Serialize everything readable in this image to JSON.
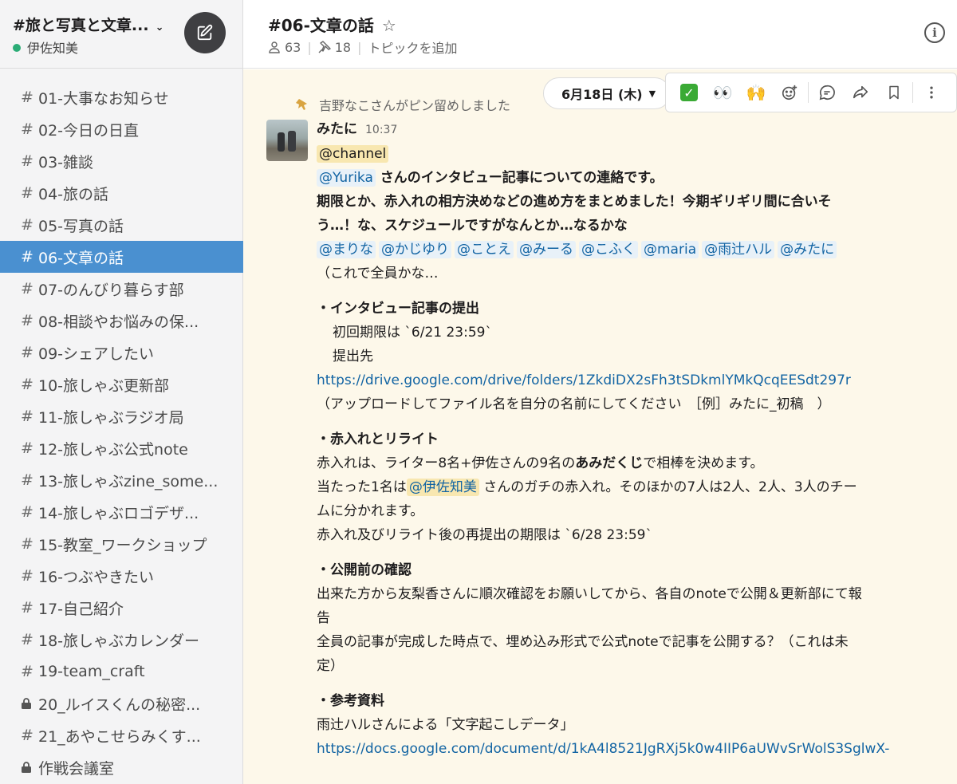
{
  "workspace": {
    "name": "#旅と写真と文章...",
    "chevron": "⌄",
    "user": "伊佐知美"
  },
  "channels": [
    {
      "prefix": "#",
      "name": "01-大事なお知らせ",
      "active": false,
      "locked": false
    },
    {
      "prefix": "#",
      "name": "02-今日の日直",
      "active": false,
      "locked": false
    },
    {
      "prefix": "#",
      "name": "03-雑談",
      "active": false,
      "locked": false
    },
    {
      "prefix": "#",
      "name": "04-旅の話",
      "active": false,
      "locked": false
    },
    {
      "prefix": "#",
      "name": "05-写真の話",
      "active": false,
      "locked": false
    },
    {
      "prefix": "#",
      "name": "06-文章の話",
      "active": true,
      "locked": false
    },
    {
      "prefix": "#",
      "name": "07-のんびり暮らす部",
      "active": false,
      "locked": false
    },
    {
      "prefix": "#",
      "name": "08-相談やお悩みの保...",
      "active": false,
      "locked": false
    },
    {
      "prefix": "#",
      "name": "09-シェアしたい",
      "active": false,
      "locked": false
    },
    {
      "prefix": "#",
      "name": "10-旅しゃぶ更新部",
      "active": false,
      "locked": false
    },
    {
      "prefix": "#",
      "name": "11-旅しゃぶラジオ局",
      "active": false,
      "locked": false
    },
    {
      "prefix": "#",
      "name": "12-旅しゃぶ公式note",
      "active": false,
      "locked": false
    },
    {
      "prefix": "#",
      "name": "13-旅しゃぶzine_some...",
      "active": false,
      "locked": false
    },
    {
      "prefix": "#",
      "name": "14-旅しゃぶロゴデザ...",
      "active": false,
      "locked": false
    },
    {
      "prefix": "#",
      "name": "15-教室_ワークショップ",
      "active": false,
      "locked": false
    },
    {
      "prefix": "#",
      "name": "16-つぶやきたい",
      "active": false,
      "locked": false
    },
    {
      "prefix": "#",
      "name": "17-自己紹介",
      "active": false,
      "locked": false
    },
    {
      "prefix": "#",
      "name": "18-旅しゃぶカレンダー",
      "active": false,
      "locked": false
    },
    {
      "prefix": "#",
      "name": "19-team_craft",
      "active": false,
      "locked": false
    },
    {
      "prefix": "",
      "name": "20_ルイスくんの秘密...",
      "active": false,
      "locked": true
    },
    {
      "prefix": "#",
      "name": "21_あやこせらみくす...",
      "active": false,
      "locked": false
    },
    {
      "prefix": "",
      "name": "作戦会議室",
      "active": false,
      "locked": true
    }
  ],
  "header": {
    "title": "#06-文章の話",
    "star": "☆",
    "members": "63",
    "pins": "18",
    "topic": "トピックを追加",
    "info": "i"
  },
  "date_pill": "6月18日 (木)",
  "actions": {
    "check": "✓",
    "eyes": "👀",
    "raised_hands": "🙌"
  },
  "pin_notice": "吉野なこさんがピン留めしました",
  "message": {
    "sender": "みたに",
    "time": "10:37",
    "channel_mention": "@channel",
    "mention_yurika": "@Yurika",
    "line1_rest": " さんのインタビュー記事についての連絡です。",
    "line2": "期限とか、赤入れの相方決めなどの進め方をまとめました！今期ギリギリ間に合いそ",
    "line3": "う…！な、スケジュールですがなんとか…なるかな",
    "mentions": [
      "@まりな",
      "@かじゆり",
      "@ことえ",
      "@みーる",
      "@こふく",
      "@maria",
      "@雨辻ハル",
      "@みたに"
    ],
    "line4": "（これで全員かな…",
    "s1_title": "・インタビュー記事の提出",
    "s1_deadline": "初回期限は `6/21 23:59`",
    "s1_dest": "提出先",
    "s1_link": "https://drive.google.com/drive/folders/1ZkdiDX2sFh3tSDkmlYMkQcqEESdt297r",
    "s1_note": "（アップロードしてファイル名を自分の名前にしてください　［例］みたに_初稿　）",
    "s2_title": "・赤入れとリライト",
    "s2_line1_a": "赤入れは、ライター8名+伊佐さんの9名の",
    "s2_line1_b": "あみだくじ",
    "s2_line1_c": "で相棒を決めます。",
    "s2_line2_a": "当たった1名は",
    "s2_line2_mention": "@伊佐知美",
    "s2_line2_b": " さんのガチの赤入れ。そのほかの7人は2人、2人、3人のチー",
    "s2_line3": "ムに分かれます。",
    "s2_line4": "赤入れ及びリライト後の再提出の期限は `6/28 23:59`",
    "s3_title": "・公開前の確認",
    "s3_line1": "出来た方から友梨香さんに順次確認をお願いしてから、各自のnoteで公開＆更新部にて報",
    "s3_line2": "告",
    "s3_line3": "全員の記事が完成した時点で、埋め込み形式で公式noteで記事を公開する？（これは未",
    "s3_line4": "定）",
    "s4_title": "・参考資料",
    "s4_line1": "雨辻ハルさんによる「文字起こしデータ」",
    "s4_link": "https://docs.google.com/document/d/1kA4l8521JgRXj5k0w4IIP6aUWvSrWolS3SglwX-"
  }
}
